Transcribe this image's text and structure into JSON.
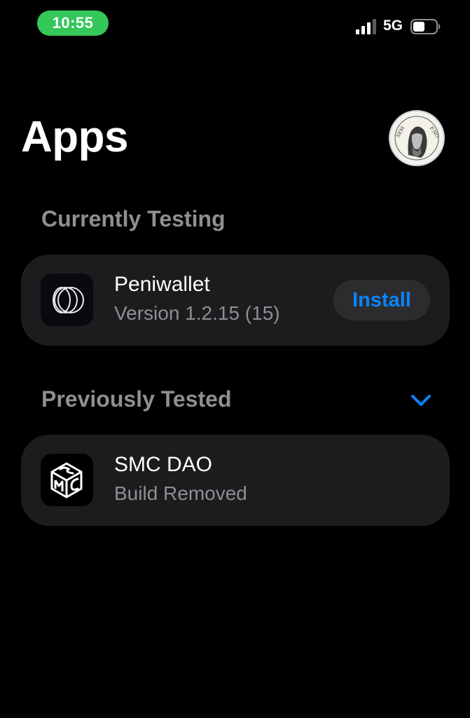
{
  "status_bar": {
    "time": "10:55",
    "network": "5G",
    "time_color": "#34c759"
  },
  "header": {
    "title": "Apps",
    "avatar_icon": "profile-avatar-engraving"
  },
  "sections": {
    "current": {
      "heading": "Currently Testing",
      "apps": [
        {
          "name": "Peniwallet",
          "subtitle": "Version 1.2.15 (15)",
          "action_label": "Install",
          "icon": "peniwallet-rings-icon"
        }
      ]
    },
    "previous": {
      "heading": "Previously Tested",
      "collapse_icon": "chevron-down-icon",
      "apps": [
        {
          "name": "SMC DAO",
          "subtitle": "Build Removed",
          "icon": "smc-dao-cube-icon"
        }
      ]
    }
  },
  "colors": {
    "background": "#000000",
    "card": "#1c1c1e",
    "accent": "#0a84ff",
    "secondary_text": "#8e8e93",
    "button_bg": "#2c2c2e"
  }
}
